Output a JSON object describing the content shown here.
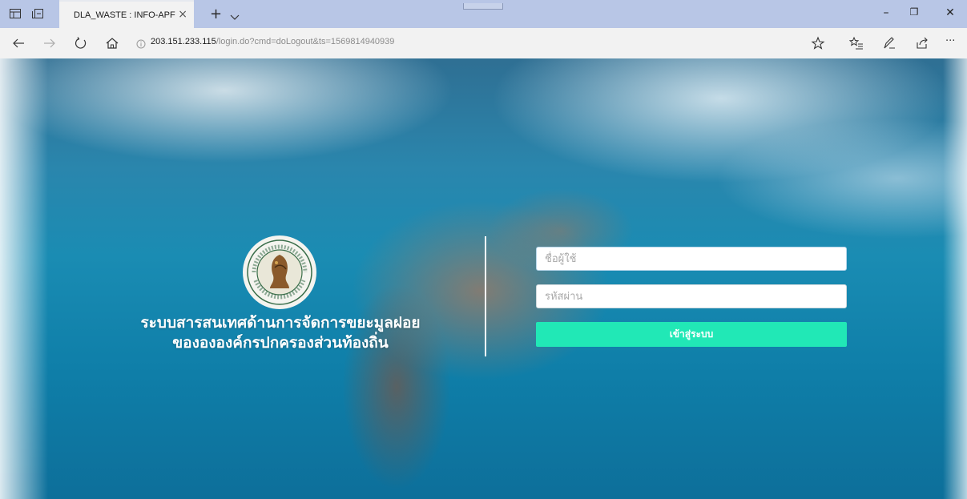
{
  "browser": {
    "tab_title": "DLA_WASTE : INFO-APF",
    "tab_close": "×",
    "new_tab": "+",
    "url_host": "203.151.233.115",
    "url_path": "/login.do?cmd=doLogout&ts=1569814940939",
    "icons": [
      "tab-manager-icon",
      "tab-preview-icon",
      "back-arrow-icon",
      "forward-arrow-icon",
      "refresh-icon",
      "home-icon",
      "info-icon",
      "favorite-star-icon",
      "favorites-list-icon",
      "pen-icon",
      "share-icon",
      "more-icon"
    ],
    "more_label": "···",
    "window_buttons": {
      "minimize": "–",
      "restore": "❐",
      "close": "✕"
    }
  },
  "login": {
    "title_line1": "ระบบสารสนเทศด้านการจัดการขยะมูลฝอย",
    "title_line2": "ของององค์กรปกครองส่วนท้องถิ่น",
    "username_placeholder": "ชื่อผู้ใช้",
    "password_placeholder": "รหัสผ่าน",
    "submit_label": "เข้าสู่ระบบ",
    "colors": {
      "button": "#21e8b6",
      "text": "#ffffff"
    }
  }
}
